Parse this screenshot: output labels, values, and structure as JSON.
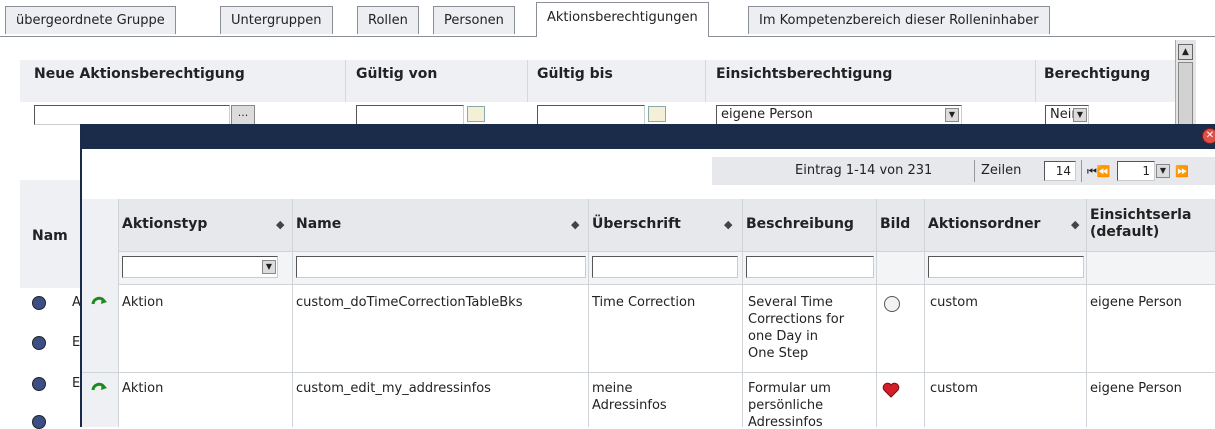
{
  "tabs": [
    {
      "label": "übergeordnete Gruppe"
    },
    {
      "label": "Untergruppen"
    },
    {
      "label": "Rollen"
    },
    {
      "label": "Personen"
    },
    {
      "label": "Aktionsberechtigungen",
      "active": true
    },
    {
      "label": "Im Kompetenzbereich dieser Rolleninhaber"
    }
  ],
  "form": {
    "headers": {
      "new_permission": "Neue Aktionsberechtigung",
      "valid_from": "Gültig von",
      "valid_to": "Gültig bis",
      "view_permission": "Einsichtsberechtigung",
      "permission": "Berechtigung"
    },
    "browse_button": "...",
    "view_permission_value": "eigene Person",
    "permission_value": "Nein",
    "name_header_partial": "Nam",
    "left_list_letters": [
      "A",
      "E",
      "E"
    ]
  },
  "popup": {
    "close_icon": "close-icon",
    "pager": {
      "entries_text": "Eintrag 1-14 von 231",
      "rows_label": "Zeilen",
      "rows_value": "14",
      "page_value": "1",
      "nav_first_prev": "⏮⏪",
      "nav_next": "⏩"
    },
    "columns": {
      "action_type": "Aktionstyp",
      "name": "Name",
      "heading": "Überschrift",
      "description": "Beschreibung",
      "image": "Bild",
      "action_folder": "Aktionsordner",
      "view_default_line1": "Einsichtserla",
      "view_default_line2": "(default)"
    },
    "rows": [
      {
        "action_type": "Aktion",
        "name": "custom_doTimeCorrectionTableBks",
        "heading": "Time Correction",
        "description": [
          "Several Time",
          "Corrections for",
          "one Day in",
          "One Step"
        ],
        "image_icon": "clock-icon",
        "action_folder": "custom",
        "view_default": "eigene Person"
      },
      {
        "action_type": "Aktion",
        "name": "custom_edit_my_addressinfos",
        "heading": [
          "meine",
          "Adressinfos"
        ],
        "description": [
          "Formular um",
          "persönliche",
          "Adressinfos"
        ],
        "image_icon": "heart-icon",
        "action_folder": "custom",
        "view_default": "eigene Person"
      }
    ]
  },
  "colors": {
    "popup_titlebar": "#1b2c4a",
    "header_bg": "#e6e8eb",
    "close": "#e0504a"
  }
}
